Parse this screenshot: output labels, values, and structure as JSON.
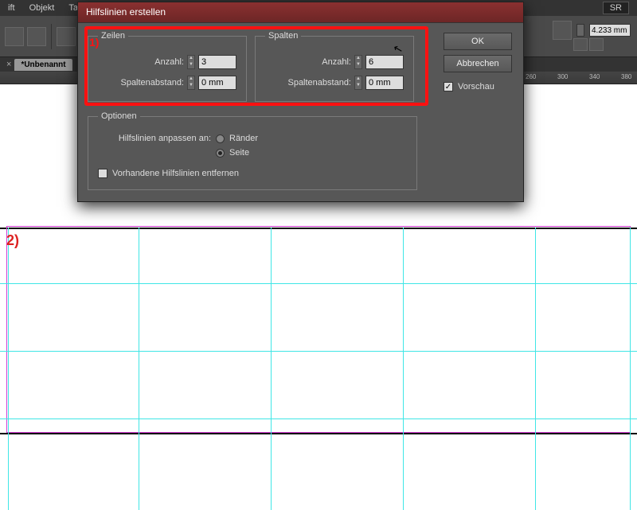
{
  "menubar": {
    "items": [
      "ift",
      "Objekt",
      "Ta"
    ],
    "workspace": "SR"
  },
  "options": {
    "size_value": "4.233 mm"
  },
  "doc_tab": {
    "label": "*Unbenannt"
  },
  "ruler": {
    "marks": [
      "260",
      "300",
      "340",
      "380"
    ]
  },
  "dialog": {
    "title": "Hilfslinien erstellen",
    "zeilen": {
      "legend": "Zeilen",
      "anzahl_label": "Anzahl:",
      "anzahl_value": "3",
      "gutter_label": "Spaltenabstand:",
      "gutter_value": "0 mm"
    },
    "spalten": {
      "legend": "Spalten",
      "anzahl_label": "Anzahl:",
      "anzahl_value": "6",
      "gutter_label": "Spaltenabstand:",
      "gutter_value": "0 mm"
    },
    "options": {
      "legend": "Optionen",
      "fit_label": "Hilfslinien anpassen an:",
      "radio_margins": "Ränder",
      "radio_page": "Seite",
      "remove_label": "Vorhandene Hilfslinien entfernen"
    },
    "ok": "OK",
    "cancel": "Abbrechen",
    "preview": "Vorschau"
  },
  "annot": {
    "step1": "1)",
    "step2": "2)"
  }
}
